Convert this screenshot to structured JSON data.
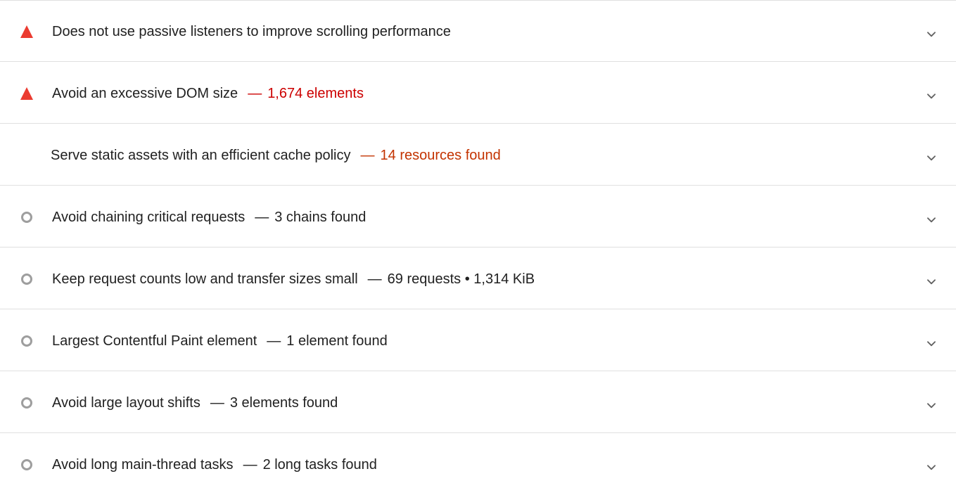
{
  "audits": [
    {
      "status": "fail",
      "title": "Does not use passive listeners to improve scrolling performance",
      "separator": "",
      "display_value": ""
    },
    {
      "status": "fail",
      "title": "Avoid an excessive DOM size",
      "separator": "—",
      "display_value": "1,674 elements"
    },
    {
      "status": "average",
      "title": "Serve static assets with an efficient cache policy",
      "separator": "—",
      "display_value": "14 resources found"
    },
    {
      "status": "info",
      "title": "Avoid chaining critical requests",
      "separator": "—",
      "display_value": "3 chains found"
    },
    {
      "status": "info",
      "title": "Keep request counts low and transfer sizes small",
      "separator": "—",
      "display_value": "69 requests • 1,314 KiB"
    },
    {
      "status": "info",
      "title": "Largest Contentful Paint element",
      "separator": "—",
      "display_value": "1 element found"
    },
    {
      "status": "info",
      "title": "Avoid large layout shifts",
      "separator": "—",
      "display_value": "3 elements found"
    },
    {
      "status": "info",
      "title": "Avoid long main-thread tasks",
      "separator": "—",
      "display_value": "2 long tasks found"
    }
  ],
  "icons": {
    "fail": "fail-triangle-icon",
    "info": "info-circle-icon",
    "expand": "chevron-down-icon"
  },
  "colors": {
    "fail_icon": "#eb3b30",
    "fail_text": "#cc0000",
    "average_text": "#c33300",
    "info_icon": "#9e9e9e",
    "divider": "#e0e0e0",
    "chevron": "#616161"
  }
}
